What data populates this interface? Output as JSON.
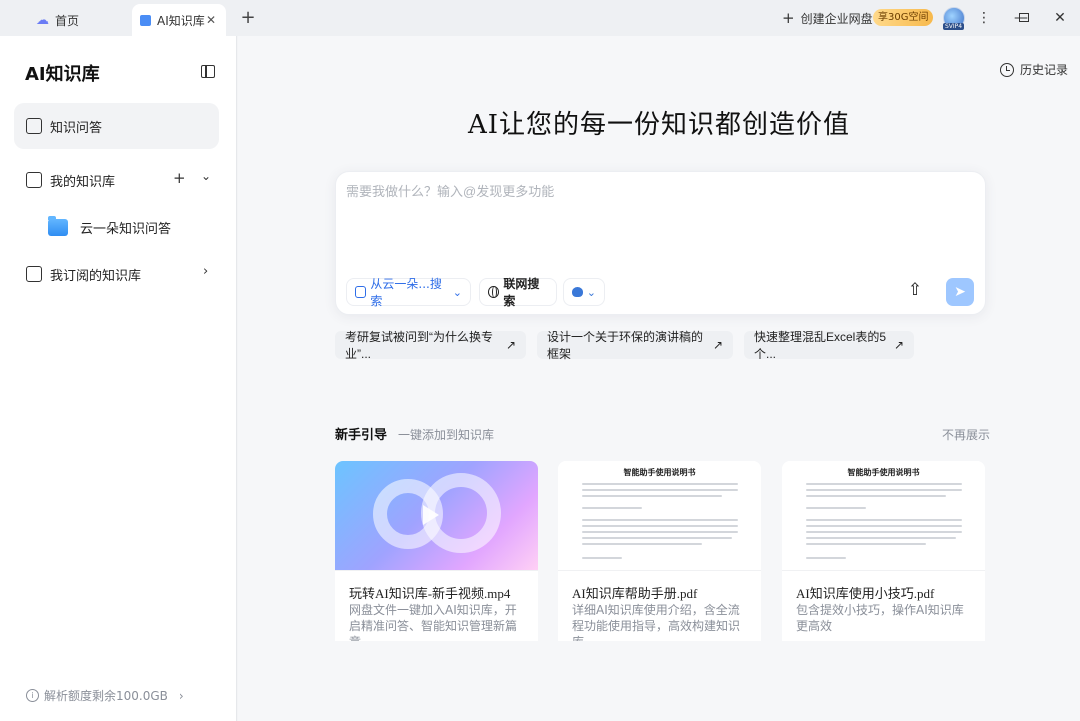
{
  "titlebar": {
    "home_tab": "首页",
    "active_tab": "AI知识库",
    "enterprise": "创建企业网盘",
    "badge": "享30G空间",
    "avatar_tag": "SVIP4"
  },
  "sidebar": {
    "title": "AI知识库",
    "items": [
      {
        "label": "知识问答"
      },
      {
        "label": "我的知识库"
      },
      {
        "label": "云一朵知识问答"
      },
      {
        "label": "我订阅的知识库"
      }
    ],
    "quota": "解析额度剩余100.0GB"
  },
  "main": {
    "history": "历史记录",
    "headline": "AI让您的每一份知识都创造价值",
    "composer": {
      "placeholder": "需要我做什么？输入@发现更多功能",
      "source_chip": "从云一朵...搜索",
      "web_chip": "联网搜索"
    },
    "suggestions": [
      "考研复试被问到“为什么换专业”...",
      "设计一个关于环保的演讲稿的框架",
      "快速整理混乱Excel表的5个..."
    ],
    "guide": {
      "title": "新手引导",
      "subtitle": "一键添加到知识库",
      "hide": "不再展示",
      "cards": [
        {
          "title": "玩转AI知识库-新手视频.mp4",
          "desc": "网盘文件一键加入AI知识库，开启精准问答、智能知识管理新篇章"
        },
        {
          "title": "AI知识库帮助手册.pdf",
          "desc": "详细AI知识库使用介绍，含全流程功能使用指导，高效构建知识库",
          "doc_heading": "智能助手使用说明书"
        },
        {
          "title": "AI知识库使用小技巧.pdf",
          "desc": "包含提效小技巧，操作AI知识库更高效",
          "doc_heading": "智能助手使用说明书"
        }
      ]
    }
  },
  "colors": {
    "accent": "#2f6ee8",
    "send": "#9ec7ff",
    "badge": "#f7b94c"
  }
}
